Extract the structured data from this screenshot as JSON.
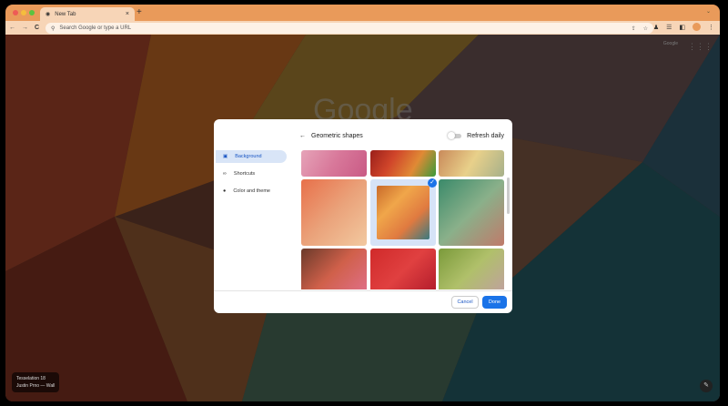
{
  "tab": {
    "title": "New Tab",
    "close": "×",
    "new": "+"
  },
  "toolbar": {
    "back": "←",
    "forward": "→",
    "reload": "C",
    "search_placeholder": "Search Google or type a URL"
  },
  "ntp": {
    "gmail_link": "Google",
    "logo": "Google",
    "attribution_title": "Tesselation 18",
    "attribution_author": "Justin Prno — Wall"
  },
  "dialog": {
    "back": "←",
    "title": "Geometric shapes",
    "refresh_label": "Refresh daily",
    "refresh_on": false,
    "sidebar": [
      {
        "label": "Background",
        "active": true
      },
      {
        "label": "Shortcuts",
        "active": false
      },
      {
        "label": "Color and theme",
        "active": false
      }
    ],
    "selected_tile": 4,
    "cancel": "Cancel",
    "done": "Done"
  },
  "colors": {
    "accent": "#1a73e8",
    "chrome": "#e99a5a"
  }
}
